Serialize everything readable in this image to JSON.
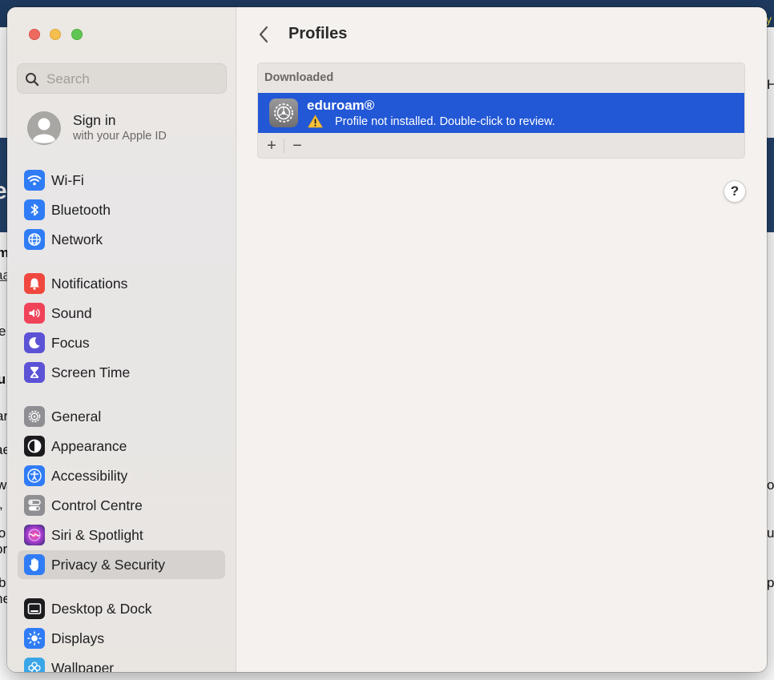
{
  "window": {
    "title": "Profiles",
    "traffic_lights": [
      "close",
      "minimize",
      "zoom"
    ]
  },
  "search": {
    "placeholder": "Search",
    "icon": "magnifying-glass-icon"
  },
  "account": {
    "title": "Sign in",
    "subtitle": "with your Apple ID",
    "icon": "person-avatar-icon"
  },
  "sidebar": {
    "selected": "Privacy & Security",
    "groups": [
      [
        {
          "label": "Wi-Fi",
          "icon": "wifi-icon",
          "color": "#2f7cf6"
        },
        {
          "label": "Bluetooth",
          "icon": "bluetooth-icon",
          "color": "#2f7cf6"
        },
        {
          "label": "Network",
          "icon": "globe-icon",
          "color": "#2f7cf6"
        }
      ],
      [
        {
          "label": "Notifications",
          "icon": "bell-icon",
          "color": "#f0483e"
        },
        {
          "label": "Sound",
          "icon": "speaker-icon",
          "color": "#f0435a"
        },
        {
          "label": "Focus",
          "icon": "moon-icon",
          "color": "#5b52d6"
        },
        {
          "label": "Screen Time",
          "icon": "hourglass-icon",
          "color": "#5b52d6"
        }
      ],
      [
        {
          "label": "General",
          "icon": "gear-icon",
          "color": "#8e8e93"
        },
        {
          "label": "Appearance",
          "icon": "appearance-icon",
          "color": "#1c1c1e"
        },
        {
          "label": "Accessibility",
          "icon": "accessibility-icon",
          "color": "#2f7cf6"
        },
        {
          "label": "Control Centre",
          "icon": "toggles-icon",
          "color": "#8e8e93"
        },
        {
          "label": "Siri & Spotlight",
          "icon": "siri-icon",
          "color": "#b13fd6"
        },
        {
          "label": "Privacy & Security",
          "icon": "hand-icon",
          "color": "#2f7cf6"
        }
      ],
      [
        {
          "label": "Desktop & Dock",
          "icon": "dock-icon",
          "color": "#1c1c1e"
        },
        {
          "label": "Displays",
          "icon": "sun-icon",
          "color": "#2f7cf6"
        },
        {
          "label": "Wallpaper",
          "icon": "flower-icon",
          "color": "#3aa6e8"
        }
      ]
    ]
  },
  "content": {
    "back_icon": "chevron-left-icon",
    "section_header": "Downloaded",
    "profiles": [
      {
        "name": "eduroam®",
        "status": "Profile not installed. Double-click to review.",
        "icon": "settings-gear-icon",
        "status_icon": "warning-triangle-icon",
        "selected": true,
        "selection_color": "#2257d6"
      }
    ],
    "add_label": "+",
    "remove_label": "−",
    "help_label": "?"
  },
  "background_page": {
    "fragments": [
      "y",
      "H",
      "e",
      "m",
      "aa",
      "e",
      "lu",
      "ar",
      "ae",
      "w",
      ",",
      "lo",
      "or",
      "b",
      "he",
      "o",
      "u",
      "p"
    ]
  }
}
